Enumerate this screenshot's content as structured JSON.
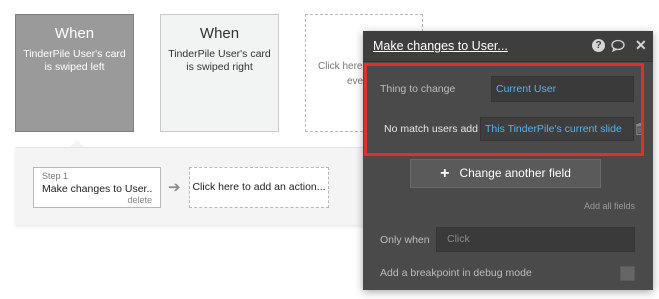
{
  "events": [
    {
      "title": "When",
      "description": "TinderPile User's card is swiped left"
    },
    {
      "title": "When",
      "description": "TinderPile User's card is swiped right"
    },
    {
      "add_text_line1": "Click here",
      "add_text_line2": "eve"
    }
  ],
  "workflow": {
    "step": {
      "number": "Step 1",
      "action": "Make changes to User...",
      "delete": "delete"
    },
    "add_action": "Click here to add an action..."
  },
  "panel": {
    "title": "Make changes to User...",
    "thing_to_change_label": "Thing to change",
    "thing_to_change_value": "Current User",
    "field_name": "No match users add",
    "field_value": "This TinderPile's current slide",
    "change_button": "Change another field",
    "add_all_fields": "Add all fields",
    "only_when_label": "Only when",
    "only_when_placeholder": "Click",
    "breakpoint_label": "Add a breakpoint in debug mode"
  },
  "colors": {
    "highlight": "#e0302a",
    "link_blue": "#5ab2e8",
    "panel_bg": "#4a4a4a"
  }
}
